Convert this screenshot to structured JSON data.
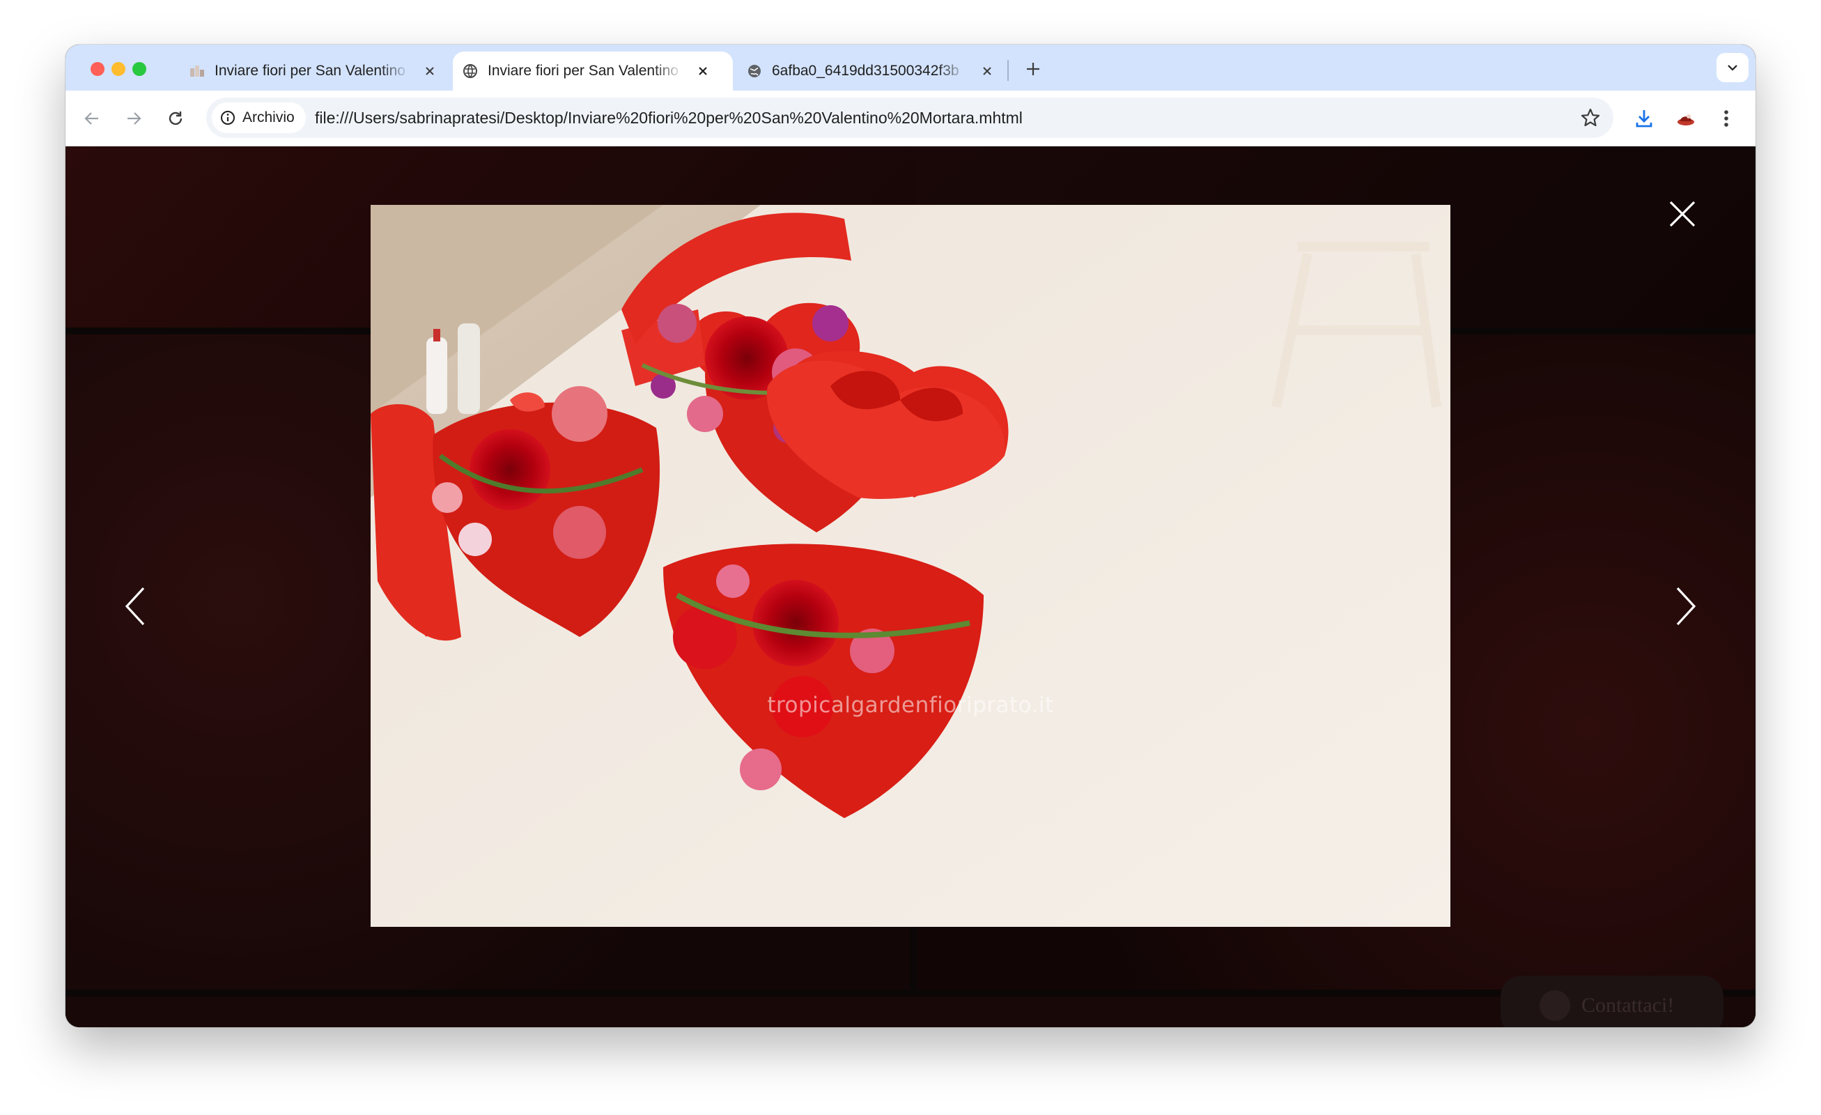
{
  "browser": {
    "tabs": [
      {
        "title": "Inviare fiori per San Valentino",
        "active": false
      },
      {
        "title": "Inviare fiori per San Valentino",
        "active": true
      },
      {
        "title": "6afba0_6419dd31500342f3b",
        "active": false
      }
    ],
    "address": {
      "chip_label": "Archivio",
      "url": "file:///Users/sabrinapratesi/Desktop/Inviare%20fiori%20per%20San%20Valentino%20Mortara.mhtml"
    },
    "icons": {
      "back": "arrow-left-icon",
      "forward": "arrow-right-icon",
      "reload": "reload-icon",
      "bookmark": "star-icon",
      "download": "download-icon",
      "extension": "extension-icon",
      "menu": "kebab-menu-icon",
      "new_tab": "plus-icon",
      "tab_search": "chevron-down-icon"
    }
  },
  "lightbox": {
    "watermark": "tropicalgardenfioriprato.it",
    "close_icon": "close-icon",
    "prev_icon": "chevron-left-icon",
    "next_icon": "chevron-right-icon"
  },
  "page": {
    "contact_label": "Contattaci!"
  },
  "colors": {
    "tabstrip_bg": "#d3e3fd",
    "box_red": "#e0261d",
    "overlay_bg": "#0c0707"
  }
}
